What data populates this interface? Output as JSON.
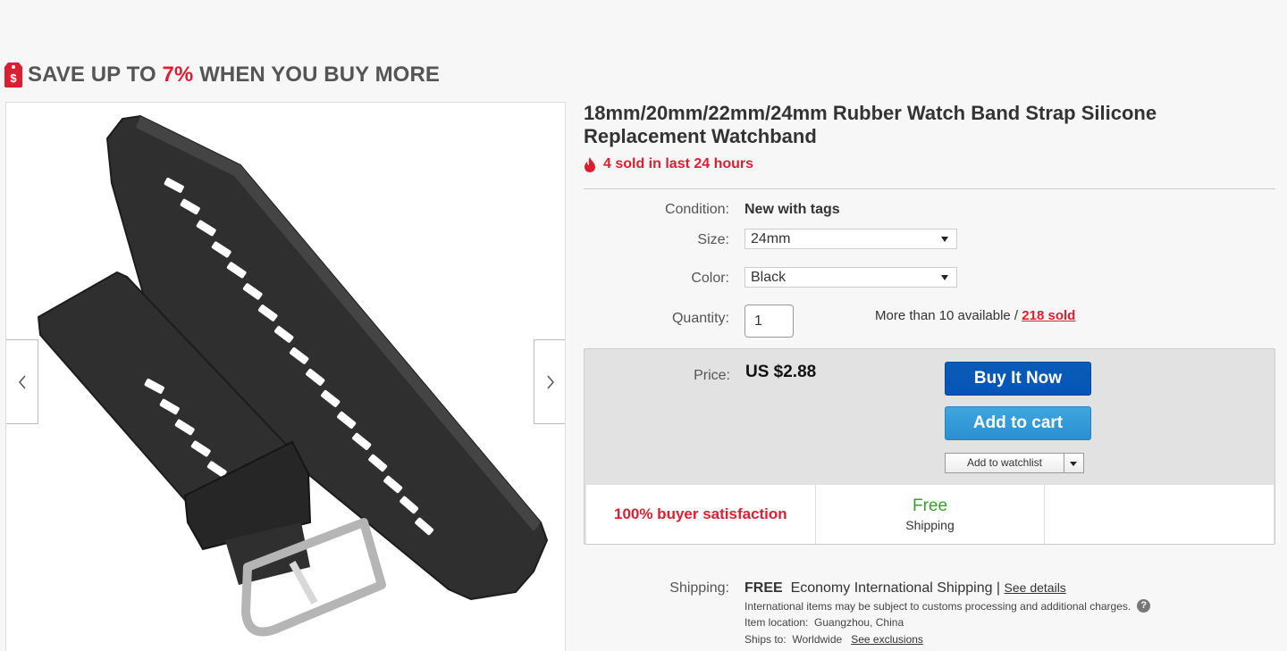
{
  "promo": {
    "prefix": "SAVE UP TO ",
    "percent": "7%",
    "suffix": " WHEN YOU BUY MORE",
    "icon": "price-tag-icon"
  },
  "product": {
    "title": "18mm/20mm/22mm/24mm Rubber Watch Band Strap Silicone Replacement Watchband",
    "sold_recent": "4 sold in last 24 hours"
  },
  "condition": {
    "label": "Condition:",
    "value": "New with tags"
  },
  "size": {
    "label": "Size:",
    "value": "24mm"
  },
  "color": {
    "label": "Color:",
    "value": "Black"
  },
  "quantity": {
    "label": "Quantity:",
    "value": "1",
    "available": "More than 10 available / ",
    "sold_link": "218 sold"
  },
  "price": {
    "label": "Price:",
    "value": "US $2.88"
  },
  "actions": {
    "buy_now": "Buy It Now",
    "add_to_cart": "Add to cart",
    "add_to_watchlist": "Add to watchlist"
  },
  "badges": {
    "satisfaction": "100% buyer satisfaction",
    "free": "Free",
    "shipping": "Shipping"
  },
  "shipping": {
    "label": "Shipping:",
    "free": "FREE",
    "method": "Economy International Shipping",
    "separator": " | ",
    "details_link": "See details",
    "note": "International items may be subject to customs processing and additional charges.",
    "location_label": "Item location:",
    "location": "Guangzhou, China",
    "ships_to_label": "Ships to:",
    "ships_to": "Worldwide",
    "exclusions_link": "See exclusions"
  },
  "colors": {
    "accent_red": "#dd1e31",
    "buy_blue": "#0654ba",
    "cart_blue": "#2b8fd0",
    "free_green": "#3a9b2e"
  }
}
